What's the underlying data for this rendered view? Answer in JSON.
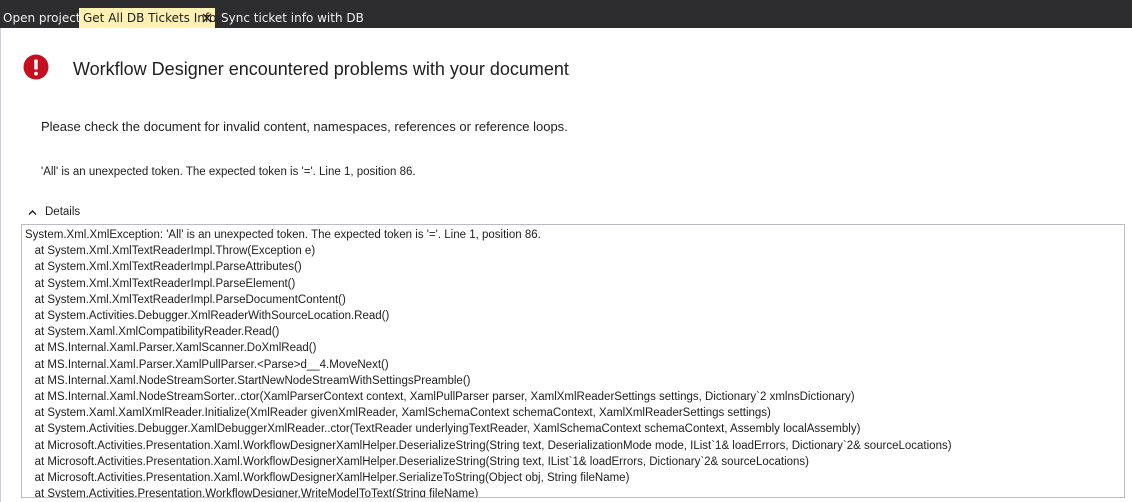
{
  "tabs": [
    {
      "label": "Open project",
      "active": false
    },
    {
      "label": "Get All DB Tickets Info",
      "active": true
    },
    {
      "label": "Sync ticket info with DB",
      "active": false
    }
  ],
  "colors": {
    "tabstrip_bg": "#2d2d30",
    "active_tab_bg": "#fff1b4",
    "error_red": "#c50f1f",
    "text": "#1e1e1e"
  },
  "icons": {
    "error": "error-icon",
    "tab_close": "close-icon",
    "details_chevron": "chevron-up-icon"
  },
  "error_page": {
    "title": "Workflow Designer encountered problems with your document",
    "message": "Please check the document for invalid content, namespaces, references or reference loops.",
    "detail_message": "'All' is an unexpected token. The expected token is '='. Line 1, position 86.",
    "details_label": "Details",
    "details_text": "System.Xml.XmlException: 'All' is an unexpected token. The expected token is '='. Line 1, position 86.\n   at System.Xml.XmlTextReaderImpl.Throw(Exception e)\n   at System.Xml.XmlTextReaderImpl.ParseAttributes()\n   at System.Xml.XmlTextReaderImpl.ParseElement()\n   at System.Xml.XmlTextReaderImpl.ParseDocumentContent()\n   at System.Activities.Debugger.XmlReaderWithSourceLocation.Read()\n   at System.Xaml.XmlCompatibilityReader.Read()\n   at MS.Internal.Xaml.Parser.XamlScanner.DoXmlRead()\n   at MS.Internal.Xaml.Parser.XamlPullParser.<Parse>d__4.MoveNext()\n   at MS.Internal.Xaml.NodeStreamSorter.StartNewNodeStreamWithSettingsPreamble()\n   at MS.Internal.Xaml.NodeStreamSorter..ctor(XamlParserContext context, XamlPullParser parser, XamlXmlReaderSettings settings, Dictionary`2 xmlnsDictionary)\n   at System.Xaml.XamlXmlReader.Initialize(XmlReader givenXmlReader, XamlSchemaContext schemaContext, XamlXmlReaderSettings settings)\n   at System.Activities.Debugger.XamlDebuggerXmlReader..ctor(TextReader underlyingTextReader, XamlSchemaContext schemaContext, Assembly localAssembly)\n   at Microsoft.Activities.Presentation.Xaml.WorkflowDesignerXamlHelper.DeserializeString(String text, DeserializationMode mode, IList`1& loadErrors, Dictionary`2& sourceLocations)\n   at Microsoft.Activities.Presentation.Xaml.WorkflowDesignerXamlHelper.DeserializeString(String text, IList`1& loadErrors, Dictionary`2& sourceLocations)\n   at Microsoft.Activities.Presentation.Xaml.WorkflowDesignerXamlHelper.SerializeToString(Object obj, String fileName)\n   at System.Activities.Presentation.WorkflowDesigner.WriteModelToText(String fileName)"
  }
}
